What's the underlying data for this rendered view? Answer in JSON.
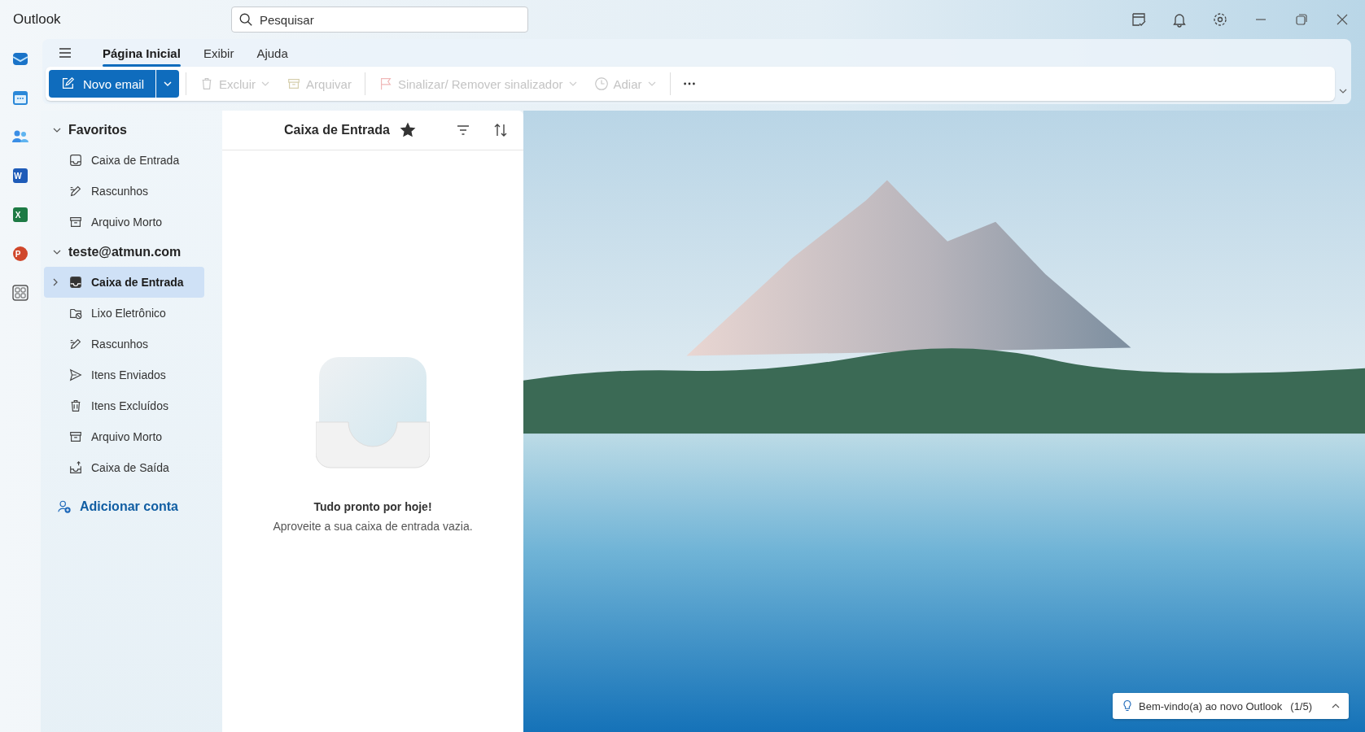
{
  "title_bar": {
    "app_name": "Outlook",
    "search": {
      "placeholder": "Pesquisar"
    }
  },
  "app_rail": [
    {
      "kind": "mail",
      "selected": true
    },
    {
      "kind": "calendar",
      "selected": false
    },
    {
      "kind": "people",
      "selected": false
    },
    {
      "kind": "word",
      "letter": "W",
      "selected": false
    },
    {
      "kind": "excel",
      "letter": "X",
      "selected": false
    },
    {
      "kind": "powerpoint",
      "letter": "P",
      "selected": false
    },
    {
      "kind": "apps",
      "selected": false
    }
  ],
  "ribbon": {
    "tabs": [
      {
        "label": "Página Inicial",
        "selected": true
      },
      {
        "label": "Exibir",
        "selected": false
      },
      {
        "label": "Ajuda",
        "selected": false
      }
    ],
    "toolbar_groups": [
      [
        {
          "kind": "new",
          "label": "Novo email",
          "disabled": false,
          "menu": true
        }
      ],
      [
        {
          "kind": "delete",
          "label": "Excluir",
          "disabled": true,
          "menu": true
        },
        {
          "kind": "archive",
          "label": "Arquivar",
          "disabled": true
        }
      ],
      [
        {
          "kind": "flag",
          "label": "Sinalizar/ Remover sinalizador",
          "disabled": true,
          "menu": true
        },
        {
          "kind": "snooze",
          "label": "Adiar",
          "disabled": true,
          "menu": true
        }
      ],
      [
        {
          "kind": "more",
          "disabled": false
        }
      ]
    ]
  },
  "folders": {
    "groups": [
      {
        "title": "Favoritos",
        "expanded": true,
        "items": [
          {
            "kind": "inbox",
            "label": "Caixa de Entrada",
            "selected": false
          },
          {
            "kind": "drafts",
            "label": "Rascunhos",
            "selected": false
          },
          {
            "kind": "archive",
            "label": "Arquivo Morto",
            "selected": false
          }
        ]
      },
      {
        "title": "teste@atmun.com",
        "expanded": true,
        "items": [
          {
            "kind": "inbox",
            "label": "Caixa de Entrada",
            "selected": true,
            "expanded": false
          },
          {
            "kind": "junk",
            "label": "Lixo Eletrônico",
            "selected": false
          },
          {
            "kind": "drafts",
            "label": "Rascunhos",
            "selected": false
          },
          {
            "kind": "sent",
            "label": "Itens Enviados",
            "selected": false
          },
          {
            "kind": "deleted",
            "label": "Itens Excluídos",
            "selected": false
          },
          {
            "kind": "archive",
            "label": "Arquivo Morto",
            "selected": false
          },
          {
            "kind": "outbox",
            "label": "Caixa de Saída",
            "selected": false
          }
        ]
      }
    ],
    "add_account": "Adicionar conta"
  },
  "message_list": {
    "title": "Caixa de Entrada",
    "starred": true,
    "empty_title": "Tudo pronto por hoje!",
    "empty_text": "Aproveite a sua caixa de entrada vazia."
  },
  "toast": {
    "text": "Bem-vindo(a) ao novo Outlook",
    "counter": "(1/5)"
  }
}
